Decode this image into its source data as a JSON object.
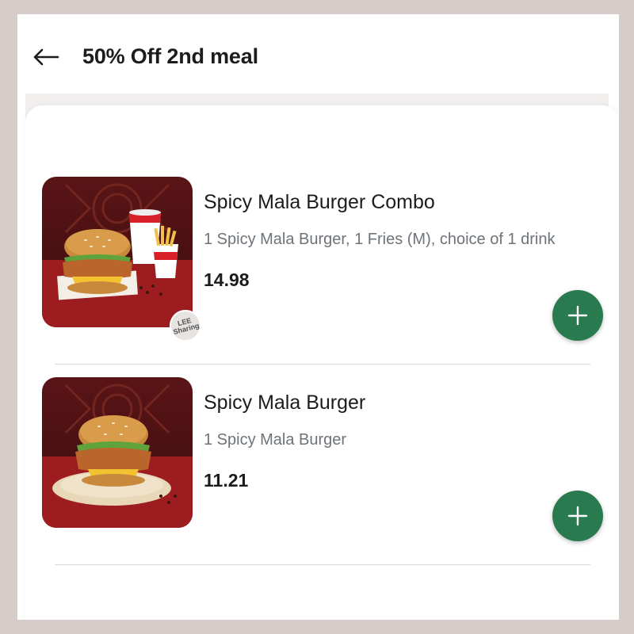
{
  "header": {
    "title": "50% Off 2nd meal"
  },
  "items": [
    {
      "name": "Spicy Mala Burger Combo",
      "description": "1 Spicy Mala Burger, 1 Fries (M), choice of 1 drink",
      "price": "14.98",
      "add_label": "+",
      "image": "spicy-mala-burger-combo-photo",
      "watermark": "LEE Sharing"
    },
    {
      "name": "Spicy Mala Burger",
      "description": "1 Spicy Mala Burger",
      "price": "11.21",
      "add_label": "+",
      "image": "spicy-mala-burger-photo"
    }
  ],
  "colors": {
    "accent": "#2a7a4f",
    "background": "#d6ccca",
    "text": "#1c1c1c",
    "muted": "#6e7378"
  }
}
